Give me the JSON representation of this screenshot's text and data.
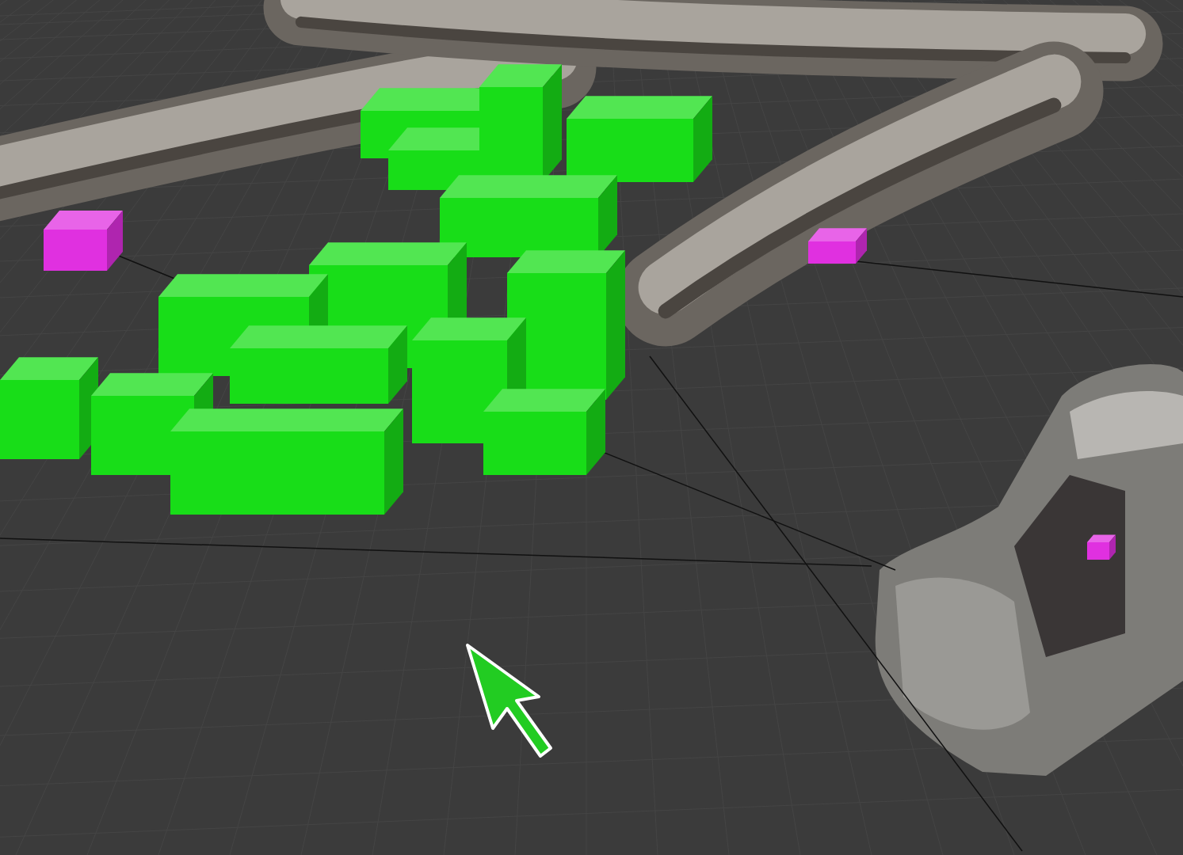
{
  "viewport": {
    "objects": [
      {
        "kind": "scan"
      },
      {
        "kind": "scan"
      },
      {
        "kind": "scan"
      },
      {
        "kind": "scan"
      },
      {
        "kind": "connector"
      },
      {
        "kind": "voxels",
        "color": "#18dd18"
      },
      {
        "kind": "marker",
        "color": "#e030e0"
      },
      {
        "kind": "marker",
        "color": "#e030e0"
      },
      {
        "kind": "marker",
        "color": "#e030e0"
      },
      {
        "kind": "cursor",
        "color": "#22cc22"
      }
    ]
  }
}
